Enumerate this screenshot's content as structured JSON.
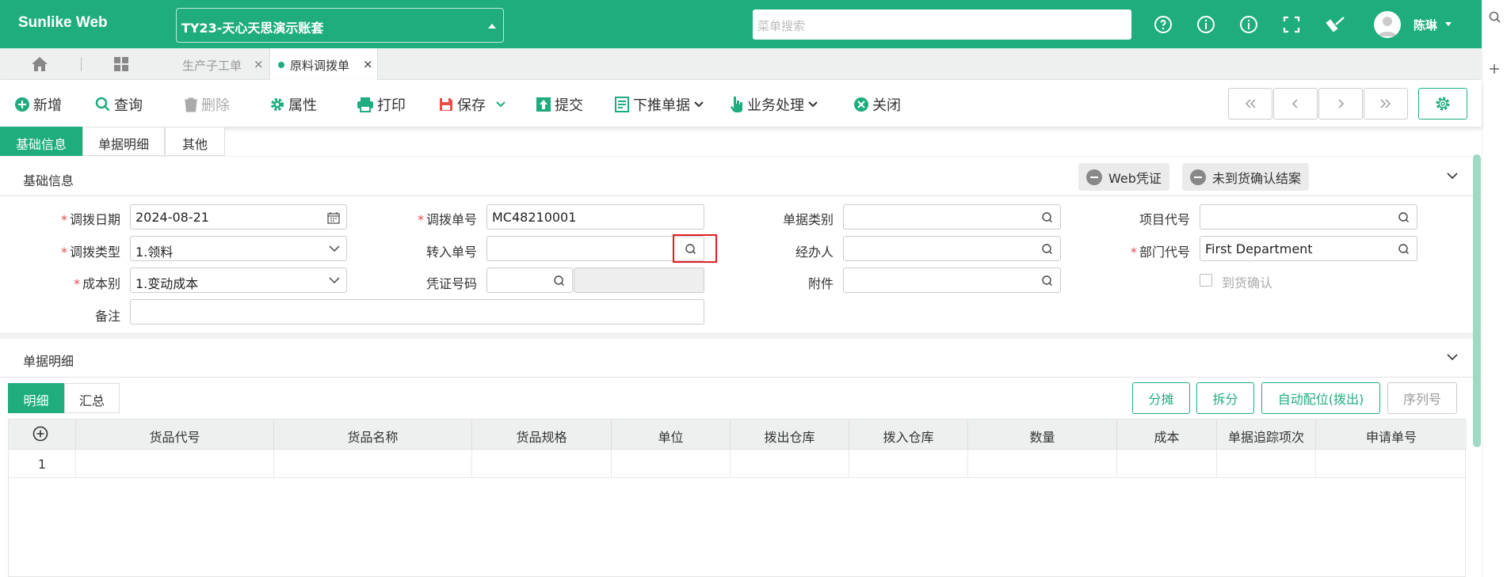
{
  "header": {
    "logo": "Sunlike Web",
    "account": "TY23-天心天思演示账套",
    "search_placeholder": "菜单搜索",
    "user": "陈琳"
  },
  "tabs": {
    "items": [
      {
        "label": "生产子工单"
      },
      {
        "label": "原料调拨单"
      }
    ]
  },
  "toolbar": {
    "new": "新增",
    "query": "查询",
    "delete": "删除",
    "attr": "属性",
    "print": "打印",
    "save": "保存",
    "submit": "提交",
    "push": "下推单据",
    "business": "业务处理",
    "close": "关闭"
  },
  "subtabs": [
    "基础信息",
    "单据明细",
    "其他"
  ],
  "basic": {
    "title": "基础信息",
    "web_voucher": "Web凭证",
    "unconfirmed": "未到货确认结案",
    "labels": {
      "date": "调拨日期",
      "type": "调拨类型",
      "cost": "成本别",
      "remark": "备注",
      "doc_no": "调拨单号",
      "in_no": "转入单号",
      "voucher_no": "凭证号码",
      "doc_class": "单据类别",
      "handler": "经办人",
      "attach": "附件",
      "project": "项目代号",
      "dept": "部门代号",
      "arrival": "到货确认"
    },
    "values": {
      "date": "2024-08-21",
      "type": "1.领料",
      "cost": "1.变动成本",
      "doc_no": "MC48210001",
      "in_no": "",
      "voucher_no": "",
      "remark": "",
      "doc_class": "",
      "handler": "",
      "attach": "",
      "project": "",
      "dept": "First Department"
    }
  },
  "detail": {
    "title": "单据明细",
    "tabs": [
      "明细",
      "汇总"
    ],
    "buttons": {
      "split_share": "分摊",
      "split": "拆分",
      "auto": "自动配位(拨出)",
      "serial": "序列号"
    },
    "columns": [
      "货品代号",
      "货品名称",
      "货品规格",
      "单位",
      "拨出仓库",
      "拨入仓库",
      "数量",
      "成本",
      "单据追踪项次",
      "申请单号"
    ],
    "rows": [
      {
        "no": "1"
      }
    ]
  },
  "colors": {
    "primary": "#1fad7e",
    "required": "#e04b4b",
    "highlight": "#e02020"
  }
}
